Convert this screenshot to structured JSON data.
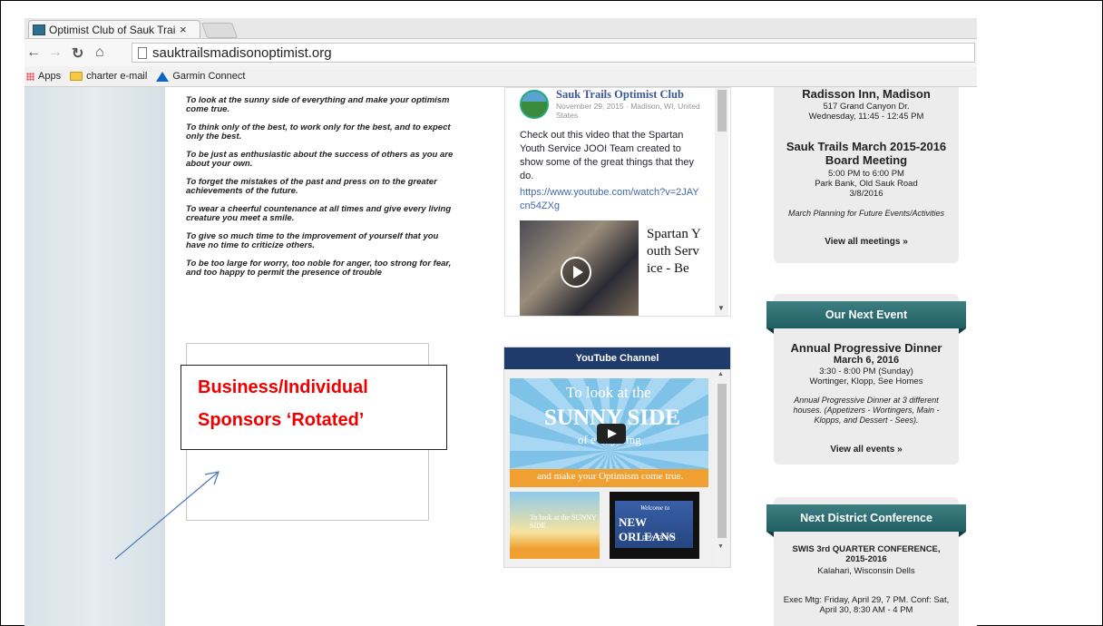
{
  "browser": {
    "tab_title": "Optimist Club of Sauk Trai",
    "tab_close": "×",
    "address": "sauktrailsmadisonoptimist.org",
    "bookmarks": [
      "Apps",
      "charter e-mail",
      "Garmin Connect"
    ]
  },
  "creed": [
    "To look at the sunny side of everything and make your optimism come true.",
    "To think only of the best, to work only for the best, and to expect only the best.",
    "To be just as enthusiastic about the success of others as you are about your own.",
    "To forget the mistakes of the past and press on to the greater achievements of the future.",
    "To wear a cheerful countenance at all times and give every living creature you meet a smile.",
    "To give so much time to the improvement of yourself that you have no time to criticize others.",
    "To be too large for worry, too noble for anger, too strong for fear, and too happy to permit the presence of trouble"
  ],
  "annotation": {
    "line1": "Business/Individual",
    "line2": "Sponsors ‘Rotated’"
  },
  "facebook": {
    "page_name": "Sauk Trails Optimist Club",
    "meta": "November 29, 2015 · Madison, WI, United States",
    "text": "Check out this video that the Spartan Youth Service JOOI Team created to show some of the great things that they do.",
    "link": "https://www.youtube.com/watch?v=2JAYcn54ZXg",
    "video_title": "Spartan Youth Service - Be"
  },
  "youtube": {
    "header": "YouTube Channel",
    "main_line1": "To look at the",
    "main_line2": "SUNNY SIDE",
    "main_line3": "of everything",
    "main_line4": "and make your Optimism come true.",
    "thumb1": "To look at the SUNNY SIDE",
    "thumb2_welcome": "Welcome to",
    "thumb2_title": "NEW ORLEANS",
    "thumb2_sub": "DOWNTOWN"
  },
  "meetings": {
    "venue": "Radisson Inn, Madison",
    "address": "517 Grand Canyon Dr.",
    "time": "Wednesday, 11:45 - 12:45 PM",
    "board_title": "Sauk Trails March 2015-2016 Board Meeting",
    "board_time": "5:00 PM to 6:00 PM",
    "board_place": "Park Bank, Old Sauk Road",
    "board_date": "3/8/2016",
    "board_note": "March Planning for Future Events/Activities",
    "view_all": "View all meetings »"
  },
  "next_event": {
    "heading": "Our Next Event",
    "title": "Annual Progressive Dinner",
    "date": "March 6, 2016",
    "time": "3:30 - 8:00 PM (Sunday)",
    "hosts": "Wortinger, Klopp, See Homes",
    "description": "Annual Progressive Dinner at 3 different houses. (Appetizers - Wortingers, Main - Klopps, and Dessert - Sees).",
    "view_all": "View all events »"
  },
  "district": {
    "heading": "Next District Conference",
    "title": "SWIS 3rd QUARTER CONFERENCE, 2015-2016",
    "location": "Kalahari, Wisconsin Dells",
    "details": "Exec Mtg: Friday, April 29, 7 PM. Conf: Sat, April 30, 8:30 AM - 4 PM"
  }
}
